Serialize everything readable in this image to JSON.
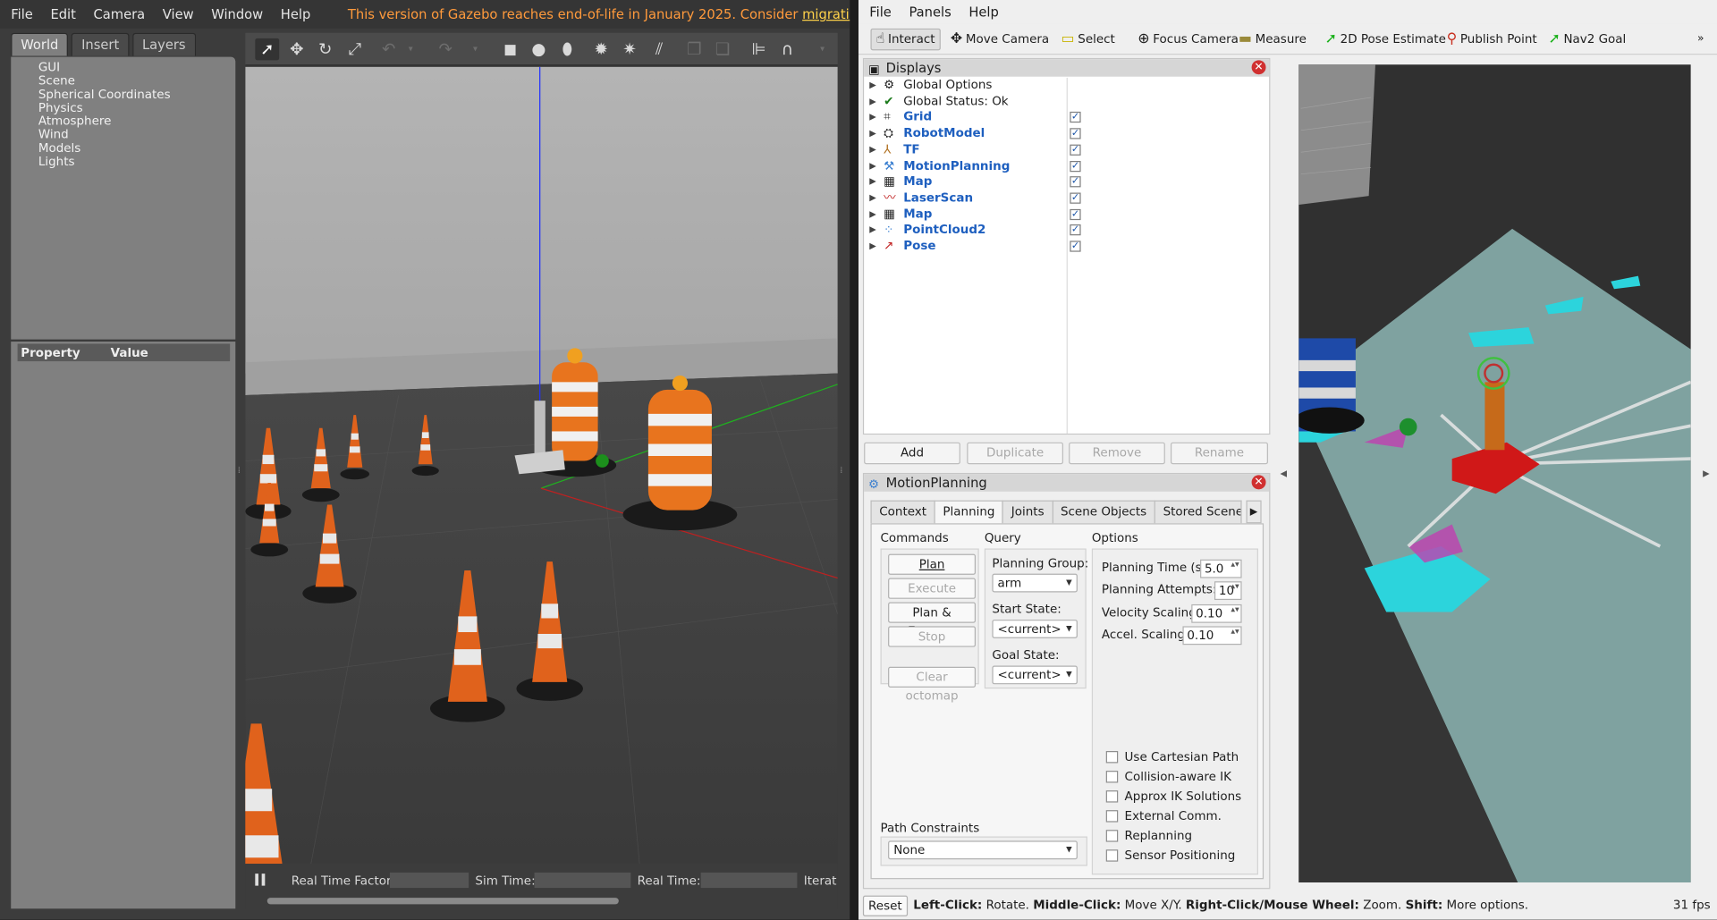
{
  "gazebo": {
    "menu": [
      "File",
      "Edit",
      "Camera",
      "View",
      "Window",
      "Help"
    ],
    "warning_text": "This version of Gazebo reaches end-of-life in January 2025. Consider ",
    "warning_link": "migrating to the new Gazebo",
    "tabs": [
      "World",
      "Insert",
      "Layers"
    ],
    "world_tree": [
      "GUI",
      "Scene",
      "Spherical Coordinates",
      "Physics",
      "Atmosphere",
      "Wind",
      "Models",
      "Lights"
    ],
    "property_header": {
      "property": "Property",
      "value": "Value"
    },
    "bottom": {
      "real_time_factor": "Real Time Factor:",
      "sim_time": "Sim Time:",
      "real_time": "Real Time:",
      "iterations": "Iterat"
    },
    "toolbar_icons": [
      "select-arrow-icon",
      "translate-icon",
      "rotate-icon",
      "scale-icon",
      "undo-icon",
      "redo-icon",
      "box-icon",
      "sphere-icon",
      "cylinder-icon",
      "point-light-icon",
      "spot-light-icon",
      "directional-light-icon",
      "copy-icon",
      "paste-icon",
      "align-icon",
      "snap-icon"
    ]
  },
  "rviz": {
    "menu": [
      "File",
      "Panels",
      "Help"
    ],
    "toolbar": [
      "Interact",
      "Move Camera",
      "Select",
      "Focus Camera",
      "Measure",
      "2D Pose Estimate",
      "Publish Point",
      "Nav2 Goal"
    ],
    "displays_title": "Displays",
    "displays": [
      {
        "label": "Global Options",
        "icon": "gear-icon",
        "bold": false,
        "checked": null
      },
      {
        "label": "Global Status: Ok",
        "icon": "check-icon",
        "bold": false,
        "checked": null
      },
      {
        "label": "Grid",
        "icon": "grid-icon",
        "bold": true,
        "checked": true
      },
      {
        "label": "RobotModel",
        "icon": "robot-icon",
        "bold": true,
        "checked": true
      },
      {
        "label": "TF",
        "icon": "tf-icon",
        "bold": true,
        "checked": true
      },
      {
        "label": "MotionPlanning",
        "icon": "motion-planning-icon",
        "bold": true,
        "checked": true
      },
      {
        "label": "Map",
        "icon": "map-icon",
        "bold": true,
        "checked": true
      },
      {
        "label": "LaserScan",
        "icon": "laserscan-icon",
        "bold": true,
        "checked": true
      },
      {
        "label": "Map",
        "icon": "map-icon",
        "bold": true,
        "checked": true
      },
      {
        "label": "PointCloud2",
        "icon": "pointcloud-icon",
        "bold": true,
        "checked": true
      },
      {
        "label": "Pose",
        "icon": "pose-icon",
        "bold": true,
        "checked": true
      }
    ],
    "display_buttons": [
      "Add",
      "Duplicate",
      "Remove",
      "Rename"
    ],
    "motion_planning": {
      "title": "MotionPlanning",
      "tabs": [
        "Context",
        "Planning",
        "Joints",
        "Scene Objects",
        "Stored Scenes"
      ],
      "active_tab": "Planning",
      "commands_label": "Commands",
      "commands": {
        "plan": "Plan",
        "execute": "Execute",
        "plan_execute": "Plan & Execute",
        "stop": "Stop",
        "clear_octomap": "Clear octomap"
      },
      "query_label": "Query",
      "planning_group_label": "Planning Group:",
      "planning_group": "arm",
      "start_state_label": "Start State:",
      "start_state": "<current>",
      "goal_state_label": "Goal State:",
      "goal_state": "<current>",
      "options_label": "Options",
      "planning_time_label": "Planning Time (s):",
      "planning_time": "5.0",
      "planning_attempts_label": "Planning Attempts:",
      "planning_attempts": "10",
      "velocity_scaling_label": "Velocity Scaling:",
      "velocity_scaling": "0.10",
      "accel_scaling_label": "Accel. Scaling:",
      "accel_scaling": "0.10",
      "checkboxes": [
        "Use Cartesian Path",
        "Collision-aware IK",
        "Approx IK Solutions",
        "External Comm.",
        "Replanning",
        "Sensor Positioning"
      ],
      "path_constraints_label": "Path Constraints",
      "path_constraints": "None"
    },
    "reset": "Reset",
    "hint": {
      "k1": "Left-Click:",
      "v1": " Rotate. ",
      "k2": "Middle-Click:",
      "v2": " Move X/Y. ",
      "k3": "Right-Click/Mouse Wheel:",
      "v3": " Zoom. ",
      "k4": "Shift:",
      "v4": " More options."
    },
    "fps": "31 fps"
  }
}
